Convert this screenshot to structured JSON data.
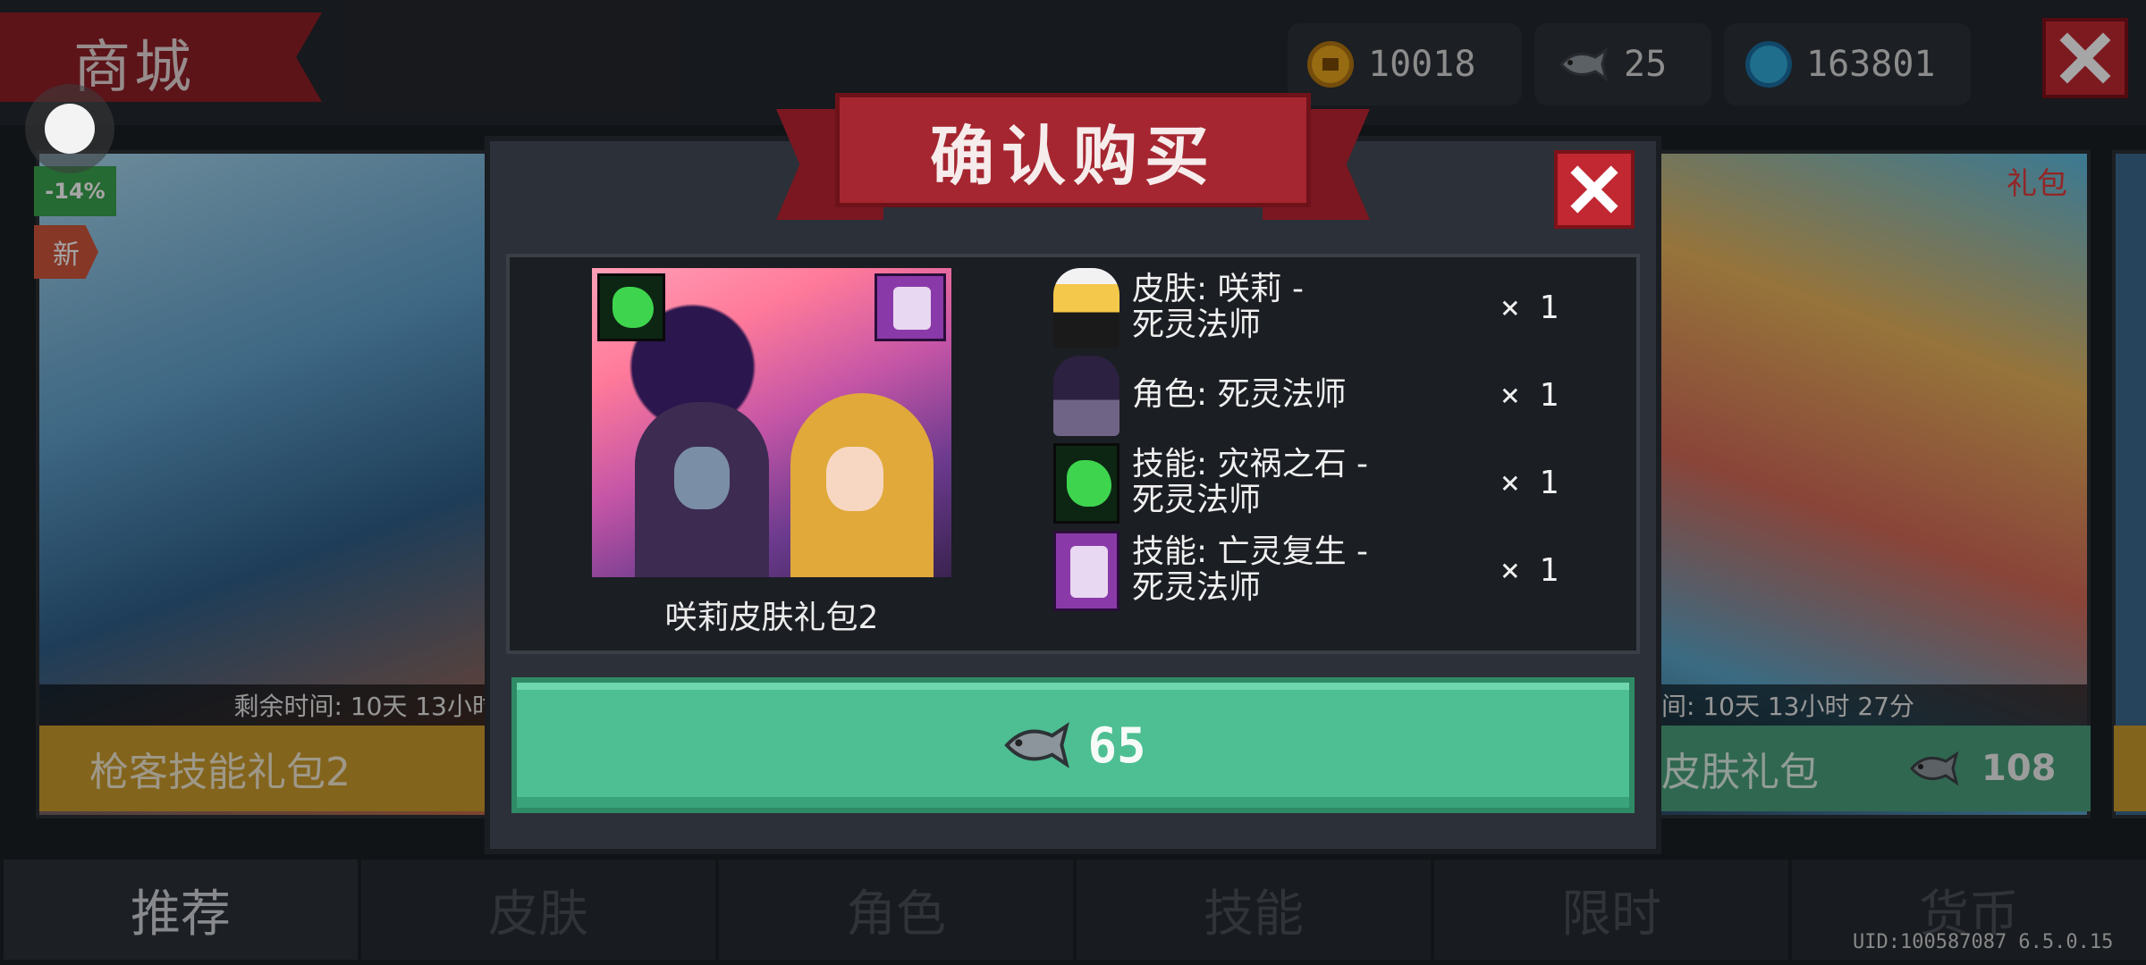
{
  "header": {
    "shop_title": "商城",
    "currencies": [
      {
        "icon": "coin-icon",
        "value": "10018",
        "color": "#e7a51d"
      },
      {
        "icon": "fish-icon",
        "value": "25",
        "color": "#9aa2a8"
      },
      {
        "icon": "gem-icon",
        "value": "163801",
        "color": "#31a9d8"
      }
    ]
  },
  "cards": {
    "left": {
      "discount": "-14%",
      "new_badge": "新",
      "timer": "剩余时间: 10天 13小时",
      "name": "枪客技能礼包2"
    },
    "right": {
      "tag": "礼包",
      "timer": "间: 10天 13小时 27分",
      "name": "皮肤礼包",
      "price": "108"
    }
  },
  "dialog": {
    "title": "确认购买",
    "pack_name": "咲莉皮肤礼包2",
    "items": [
      {
        "icon": "maid-skin-icon",
        "label": "皮肤: 咲莉 -\n死灵法师",
        "qty": "× 1"
      },
      {
        "icon": "necromancer-icon",
        "label": "角色: 死灵法师",
        "qty": "× 1"
      },
      {
        "icon": "disaster-stone-icon",
        "label": "技能: 灾祸之石 -\n死灵法师",
        "qty": "× 1"
      },
      {
        "icon": "undead-revival-icon",
        "label": "技能: 亡灵复生 -\n死灵法师",
        "qty": "× 1"
      }
    ],
    "buy_price": "65",
    "buy_currency_icon": "fish-icon"
  },
  "tabs": [
    {
      "label": "推荐",
      "active": true
    },
    {
      "label": "皮肤",
      "active": false
    },
    {
      "label": "角色",
      "active": false
    },
    {
      "label": "技能",
      "active": false
    },
    {
      "label": "限时",
      "active": false
    },
    {
      "label": "货币",
      "active": false
    }
  ],
  "footer": {
    "uid": "UID:100587087 6.5.0.15"
  },
  "colors": {
    "accent_red": "#a52630",
    "buy_green": "#4dbf93",
    "card_gold": "#c99a2b"
  }
}
